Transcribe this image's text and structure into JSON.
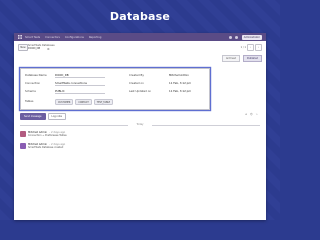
{
  "hero": {
    "title": "Database"
  },
  "colors": {
    "background": "#2c3b8f",
    "stripe": "#34449b",
    "topbar": "#5a4b86",
    "focus_ring": "#5f6fd1",
    "avatar_1": "#b25b80",
    "avatar_2": "#8a5db3"
  },
  "topbar": {
    "icon": "grid-icon",
    "app_name": "Smart Tests",
    "menus": [
      "Connectors",
      "Configurations",
      "Reporting"
    ],
    "user_label": "Administrator"
  },
  "control": {
    "new_label": "New",
    "breadcrumb_parent": "SmartTests Databases",
    "breadcrumb_title": "DOOD_DB",
    "pager": "1 / 1"
  },
  "status": {
    "archive_label": "Archived",
    "active_label": "Published"
  },
  "form": {
    "left": [
      {
        "label": "Database Name",
        "value": "DOOD_DB"
      },
      {
        "label": "Connection",
        "value": "SmartTests connections"
      },
      {
        "label": "Schema",
        "value": "PUBLIC"
      },
      {
        "label": "Tables",
        "value": ""
      }
    ],
    "right": [
      {
        "label": "Created By",
        "value": "Mitchell Admin"
      },
      {
        "label": "Created on",
        "value": "11 Feb, 3:12 pm"
      },
      {
        "label": "Last Updated on",
        "value": "11 Feb, 3:12 pm"
      }
    ],
    "tags": [
      "CUSTOMER",
      "CONTACT",
      "TEST_TABLE"
    ]
  },
  "chatter": {
    "send_label": "Send message",
    "note_label": "Log note",
    "icons": [
      "paperclip-icon",
      "follower-icon",
      "star-icon"
    ],
    "divider": "Today",
    "messages": [
      {
        "author": "Mitchell Admin",
        "time": "- 2 days ago",
        "body": "Connection → PostGrease Tables"
      },
      {
        "author": "Mitchell Admin",
        "time": "- 2 days ago",
        "body": "SmartTests Database created"
      }
    ]
  }
}
